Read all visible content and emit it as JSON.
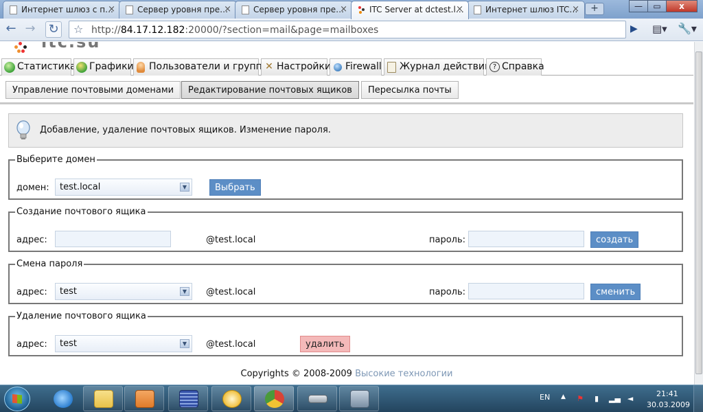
{
  "browser": {
    "tabs": [
      {
        "title": "Интернет шлюз с п…",
        "active": false
      },
      {
        "title": "Сервер уровня пре…",
        "active": false
      },
      {
        "title": "Сервер уровня пре…",
        "active": false
      },
      {
        "title": "ITC Server at dctest.l…",
        "active": true
      },
      {
        "title": "Интернет шлюз ITC…",
        "active": false
      }
    ],
    "new_tab": "+",
    "window_controls": {
      "minimize": "—",
      "maximize": "▭",
      "close": "x"
    },
    "nav": {
      "back": "←",
      "forward": "→",
      "reload": "↻",
      "star": "☆",
      "go": "▶",
      "page_menu": "▤▾",
      "tools_menu": "🔧▾"
    },
    "address": {
      "scheme": "http://",
      "host": "84.17.12.182",
      "rest": ":20000/?section=mail&page=mailboxes"
    }
  },
  "app": {
    "main_nav": [
      {
        "label": "Статистика",
        "icon": "stats-icon",
        "color": "#3fa33a"
      },
      {
        "label": "Графики",
        "icon": "charts-icon",
        "color": "#3fa33a"
      },
      {
        "label": "Пользователи и группы",
        "icon": "users-icon",
        "color": "#e08a3a"
      },
      {
        "label": "Настройки",
        "icon": "tools-icon",
        "color": "#c8a040"
      },
      {
        "label": "Firewall",
        "icon": "globe-icon",
        "color": "#3f7fbf"
      },
      {
        "label": "Журнал действий",
        "icon": "clipboard-icon",
        "color": "#c7b27a"
      },
      {
        "label": "Справка",
        "icon": "help-icon",
        "color": "#333333"
      }
    ],
    "sub_nav": [
      {
        "label": "Управление почтовыми доменами",
        "active": false
      },
      {
        "label": "Редактирование почтовых ящиков",
        "active": true
      },
      {
        "label": "Пересылка почты",
        "active": false
      }
    ],
    "info": "Добавление, удаление почтовых ящиков. Изменение пароля.",
    "select_domain": {
      "legend": "Выберите домен",
      "label": "домен:",
      "value": "test.local",
      "button": "Выбрать"
    },
    "create_mailbox": {
      "legend": "Создание почтового ящика",
      "address_label": "адрес:",
      "address_value": "",
      "domain_suffix": "@test.local",
      "password_label": "пароль:",
      "password_value": "",
      "button": "создать"
    },
    "change_password": {
      "legend": "Смена пароля",
      "address_label": "адрес:",
      "address_value": "test",
      "domain_suffix": "@test.local",
      "password_label": "пароль:",
      "password_value": "",
      "button": "сменить"
    },
    "delete_mailbox": {
      "legend": "Удаление почтового ящика",
      "address_label": "адрес:",
      "address_value": "test",
      "domain_suffix": "@test.local",
      "button": "удалить"
    },
    "footer": {
      "text": "Copyrights © 2008-2009 ",
      "link": "Высокие технологии"
    }
  },
  "taskbar": {
    "items": [
      {
        "name": "ie",
        "color": "#2d7fd0"
      },
      {
        "name": "explorer",
        "color": "#e8c24a"
      },
      {
        "name": "media-player",
        "color": "#e07b2a"
      },
      {
        "name": "network-app",
        "color": "#3552a8"
      },
      {
        "name": "outlook",
        "color": "#f0c040"
      },
      {
        "name": "chrome",
        "color": "#4a9a3a"
      },
      {
        "name": "drive",
        "color": "#9aa4ad"
      },
      {
        "name": "paint-tool",
        "color": "#7b8fa4"
      }
    ],
    "lang": "EN",
    "tray_arrow": "▲",
    "time": "21:41",
    "date": "30.03.2009"
  }
}
